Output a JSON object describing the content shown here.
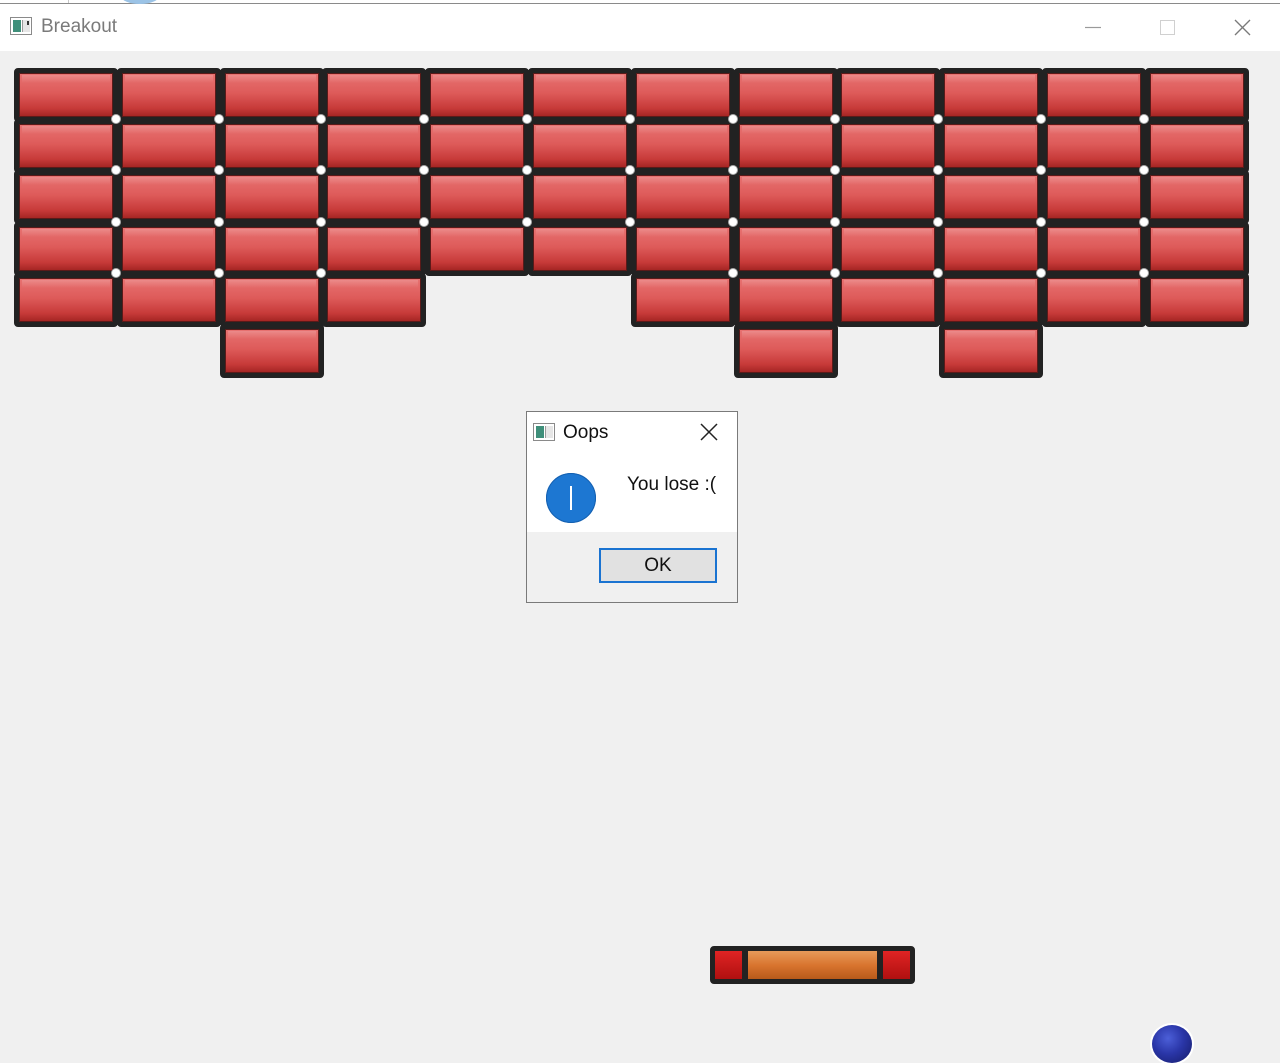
{
  "window": {
    "title": "Breakout",
    "icon": "app-window-icon",
    "controls": [
      "minimize-icon",
      "maximize-icon",
      "close-icon"
    ]
  },
  "board": {
    "brick_color": "#d94b4a",
    "brick_border_color": "#222222",
    "rows": [
      [
        1,
        1,
        1,
        1,
        1,
        1,
        1,
        1,
        1,
        1,
        1,
        1
      ],
      [
        1,
        1,
        1,
        1,
        1,
        1,
        1,
        1,
        1,
        1,
        1,
        1
      ],
      [
        1,
        1,
        1,
        1,
        1,
        1,
        1,
        1,
        1,
        1,
        1,
        1
      ],
      [
        1,
        1,
        1,
        1,
        1,
        1,
        1,
        1,
        1,
        1,
        1,
        1
      ],
      [
        1,
        1,
        1,
        1,
        0,
        0,
        1,
        1,
        1,
        1,
        1,
        1
      ],
      [
        0,
        0,
        1,
        0,
        0,
        0,
        0,
        1,
        0,
        1,
        0,
        0
      ]
    ],
    "paddle_colors": {
      "caps": "#c91818",
      "middle": "#d9752f"
    },
    "ball_color": "#2a36a8"
  },
  "dialog": {
    "title": "Oops",
    "message": "You lose :(",
    "ok_label": "OK",
    "icon": "info-icon"
  }
}
